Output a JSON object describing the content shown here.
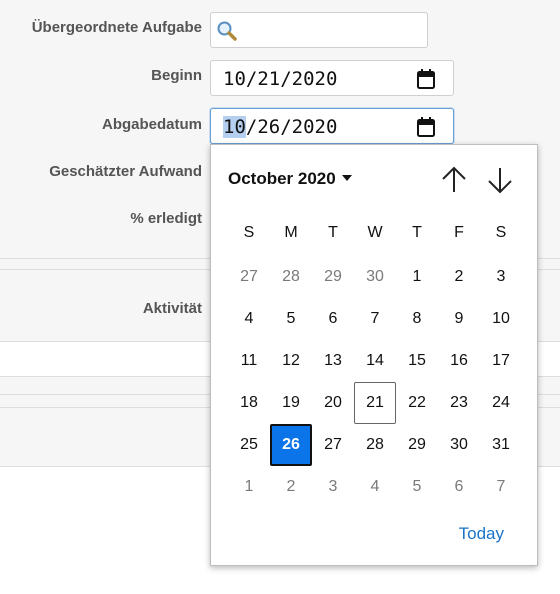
{
  "form": {
    "parent_task_label": "Übergeordnete Aufgabe",
    "start_label": "Beginn",
    "start_value": "10/21/2020",
    "due_label": "Abgabedatum",
    "due_value_selected": "10",
    "due_value_rest": "/26/2020",
    "estimated_label": "Geschätzter Aufwand",
    "done_label": "% erledigt",
    "activity_label": "Aktivität"
  },
  "calendar": {
    "month_title": "October 2020",
    "weekdays": [
      "S",
      "M",
      "T",
      "W",
      "T",
      "F",
      "S"
    ],
    "weeks": [
      [
        {
          "d": "27",
          "o": true
        },
        {
          "d": "28",
          "o": true
        },
        {
          "d": "29",
          "o": true
        },
        {
          "d": "30",
          "o": true
        },
        {
          "d": "1"
        },
        {
          "d": "2"
        },
        {
          "d": "3"
        }
      ],
      [
        {
          "d": "4"
        },
        {
          "d": "5"
        },
        {
          "d": "6"
        },
        {
          "d": "7"
        },
        {
          "d": "8"
        },
        {
          "d": "9"
        },
        {
          "d": "10"
        }
      ],
      [
        {
          "d": "11"
        },
        {
          "d": "12"
        },
        {
          "d": "13"
        },
        {
          "d": "14"
        },
        {
          "d": "15"
        },
        {
          "d": "16"
        },
        {
          "d": "17"
        }
      ],
      [
        {
          "d": "18"
        },
        {
          "d": "19"
        },
        {
          "d": "20"
        },
        {
          "d": "21",
          "today": true
        },
        {
          "d": "22"
        },
        {
          "d": "23"
        },
        {
          "d": "24"
        }
      ],
      [
        {
          "d": "25"
        },
        {
          "d": "26",
          "selected": true
        },
        {
          "d": "27"
        },
        {
          "d": "28"
        },
        {
          "d": "29"
        },
        {
          "d": "30"
        },
        {
          "d": "31"
        }
      ],
      [
        {
          "d": "1",
          "o": true
        },
        {
          "d": "2",
          "o": true
        },
        {
          "d": "3",
          "o": true
        },
        {
          "d": "4",
          "o": true
        },
        {
          "d": "5",
          "o": true
        },
        {
          "d": "6",
          "o": true
        },
        {
          "d": "7",
          "o": true
        }
      ]
    ],
    "today_label": "Today",
    "selected_color": "#0a74e8",
    "link_color": "#1a73c8"
  },
  "icons": {
    "search": "magnifier-icon",
    "calendar": "calendar-icon",
    "up": "arrow-up-icon",
    "down": "arrow-down-icon"
  }
}
